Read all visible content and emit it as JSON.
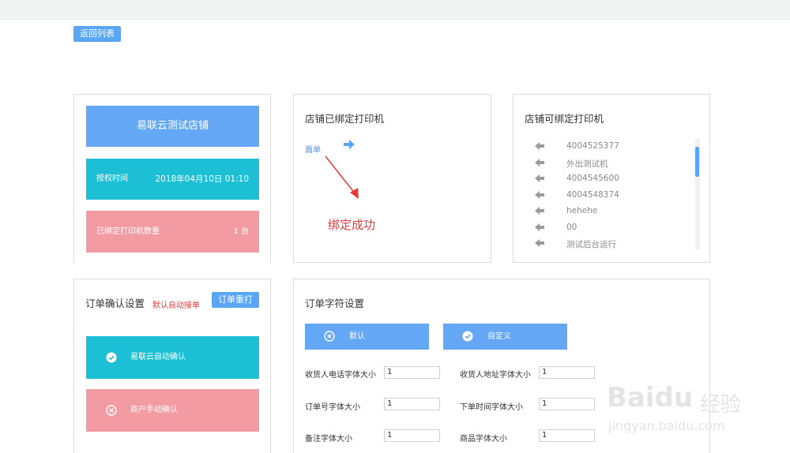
{
  "header": {
    "back_label": "返回列表"
  },
  "shop": {
    "name": "易联云测试店铺",
    "auth_label": "授权时间",
    "auth_value": "2018年04月10日 01:10",
    "count_label": "已绑定打印机数量",
    "count_value": "1 台"
  },
  "bound": {
    "title": "店铺已绑定打印机",
    "items": [
      "面单"
    ],
    "annotation": "绑定成功"
  },
  "available": {
    "title": "店铺可绑定打印机",
    "printers": [
      "4004525377",
      "外出测试机",
      "4004545600",
      "4004548374",
      "hehehe",
      "00",
      "测试后台运行"
    ]
  },
  "order_confirm": {
    "title": "订单确认设置",
    "hint": "默认自动接单",
    "reprint_label": "订单重打",
    "auto_label": "易联云自动确认",
    "manual_label": "商户手动确认"
  },
  "order_chars": {
    "title": "订单字符设置",
    "default_label": "默认",
    "custom_label": "自定义",
    "fields": [
      {
        "label": "收货人电话字体大小",
        "value": "1"
      },
      {
        "label": "收货人地址字体大小",
        "value": "1"
      },
      {
        "label": "订单号字体大小",
        "value": "1"
      },
      {
        "label": "下单时间字体大小",
        "value": "1"
      },
      {
        "label": "备注字体大小",
        "value": "1"
      },
      {
        "label": "商品字体大小",
        "value": "1"
      }
    ]
  },
  "watermark": {
    "brand": "Baidu",
    "cn": "经验",
    "url": "jingyan.baidu.com"
  },
  "colors": {
    "accent": "#5aa6f6",
    "teal": "#1dbfd5",
    "pink": "#f39ba2",
    "alert": "#e33b3b"
  }
}
